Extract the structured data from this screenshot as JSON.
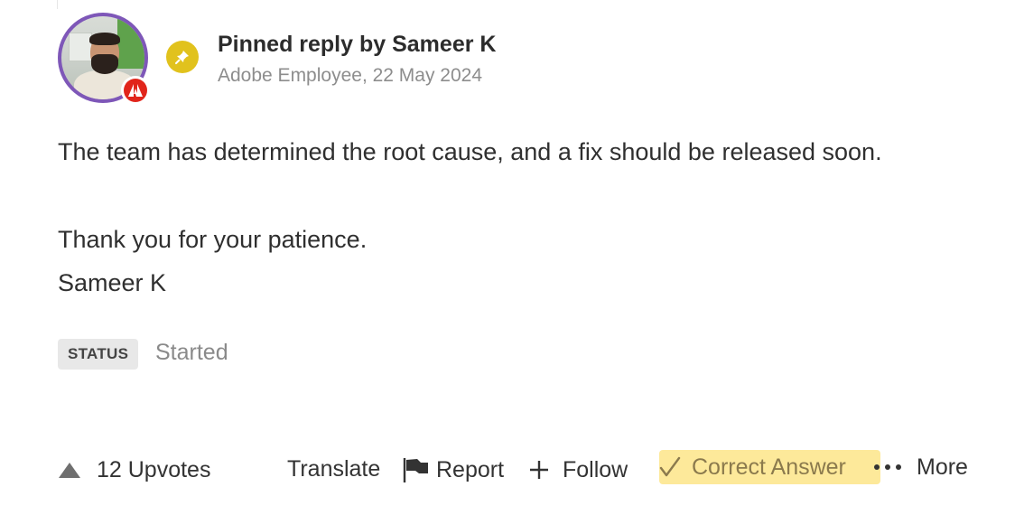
{
  "post": {
    "title": "Pinned reply by Sameer K",
    "meta": "Adobe Employee, 22 May 2024",
    "body": [
      "The team has determined the root cause, and a fix should be released soon.",
      "Thank you for your patience.",
      "Sameer K"
    ]
  },
  "status": {
    "label": "STATUS",
    "value": "Started"
  },
  "actions": {
    "upvotes": "12 Upvotes",
    "translate": "Translate",
    "report": "Report",
    "follow": "Follow",
    "correct_answer": "Correct Answer",
    "more": "More"
  },
  "icons": {
    "avatar_badge": "adobe-logo-icon",
    "pin": "pin-icon",
    "upvote": "triangle-up-icon",
    "report": "flag-icon",
    "follow": "plus-icon",
    "correct": "checkmark-icon",
    "more": "ellipsis-icon"
  },
  "colors": {
    "pin_badge": "#e1c21d",
    "adobe_red": "#e1251b",
    "avatar_ring": "#7e57b8",
    "correct_answer_bg": "#fde99a",
    "status_chip_bg": "#e8e8e8"
  }
}
